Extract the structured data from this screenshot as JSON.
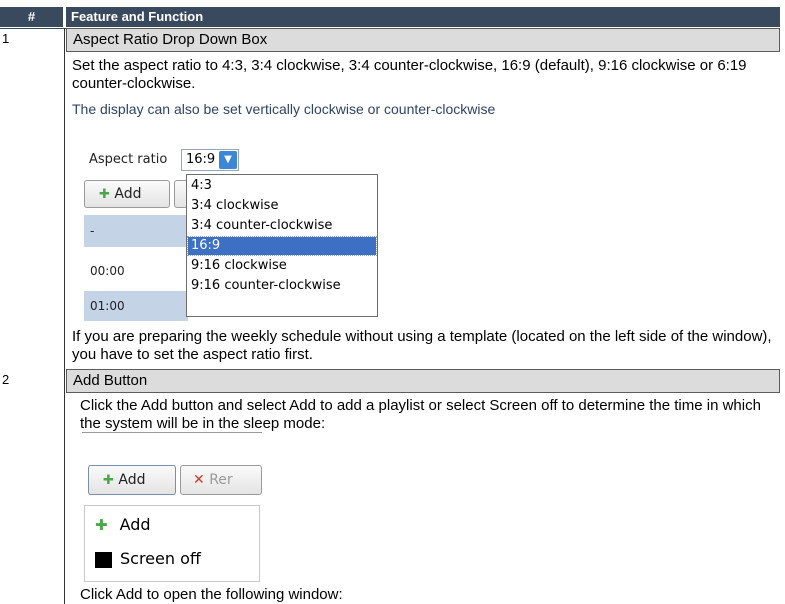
{
  "table": {
    "header": {
      "num": "#",
      "feature": "Feature and Function"
    },
    "rows": [
      {
        "num": "1",
        "title": "Aspect Ratio Drop Down Box",
        "desc": "Set the aspect ratio to 4:3, 3:4 clockwise, 3:4 counter-clockwise, 16:9 (default), 9:16 clockwise or 6:19 counter-clockwise.",
        "note": "The display can also be set vertically clockwise or counter-clockwise",
        "after": "If you are preparing the weekly schedule without using a template (located on the left side of the window), you have to set the aspect ratio first."
      },
      {
        "num": "2",
        "title": "Add Button",
        "desc": "Click the Add button and select Add to add a playlist or select Screen off to determine the time in which the system will be in the sleep mode:",
        "after": "Click Add to open the following window:"
      }
    ]
  },
  "screenshot1": {
    "label": "Aspect ratio",
    "selected": "16:9",
    "add_button": "Add",
    "grid_header": "-",
    "times": [
      "00:00",
      "01:00"
    ],
    "options": [
      "4:3",
      "3:4 clockwise",
      "3:4 counter-clockwise",
      "16:9",
      "9:16 clockwise",
      "9:16 counter-clockwise"
    ],
    "selected_index": 3
  },
  "screenshot2": {
    "add_button": "Add",
    "remove_button": "Rer",
    "menu": [
      "Add",
      "Screen off"
    ]
  }
}
